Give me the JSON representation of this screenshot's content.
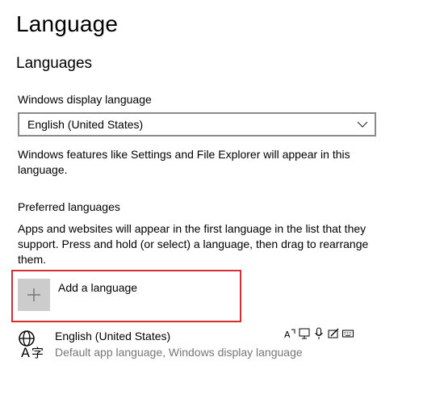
{
  "page": {
    "title": "Language"
  },
  "languages": {
    "heading": "Languages",
    "display_language": {
      "label": "Windows display language",
      "selected": "English (United States)"
    },
    "display_language_note": "Windows features like Settings and File Explorer will appear in this language."
  },
  "preferred": {
    "label": "Preferred languages",
    "description": "Apps and websites will appear in the first language in the list that they support. Press and hold (or select) a language, then drag to rearrange them.",
    "add_label": "Add a language",
    "highlight_color": "#d32f2f",
    "items": [
      {
        "name": "English (United States)",
        "subtitle": "Default app language, Windows display language",
        "icon": "language-icon",
        "feature_icons": [
          "text-to-speech-icon",
          "display-language-icon",
          "speech-recognition-icon",
          "handwriting-icon",
          "keyboard-icon"
        ]
      }
    ]
  }
}
